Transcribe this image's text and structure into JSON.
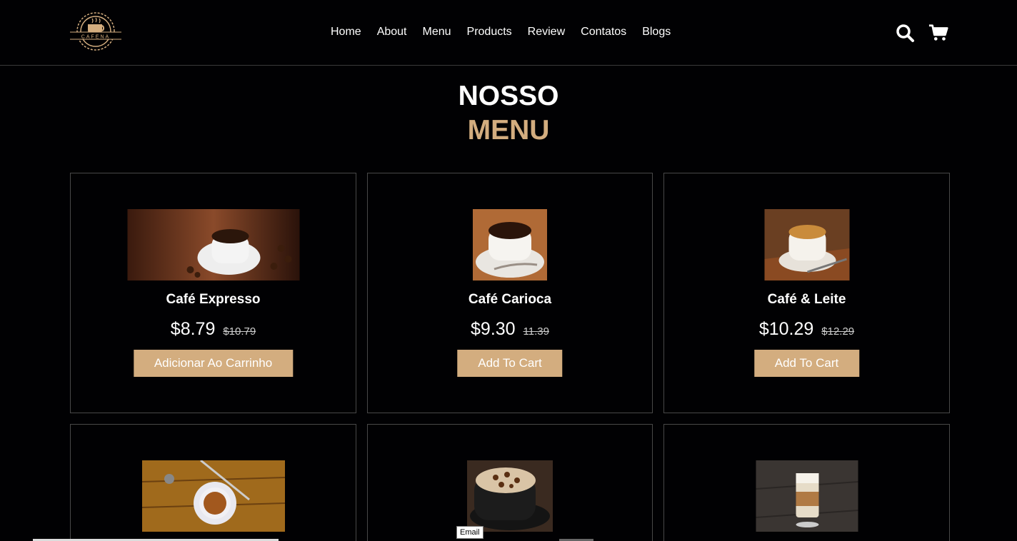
{
  "brand": {
    "logo_text": "CAFENA"
  },
  "nav": [
    "Home",
    "About",
    "Menu",
    "Products",
    "Review",
    "Contatos",
    "Blogs"
  ],
  "header_icons": {
    "search": "search-icon",
    "cart": "cart-icon"
  },
  "section": {
    "title_line1": "NOSSO",
    "title_line2": "MENU",
    "accent_color": "#d3ad7f"
  },
  "products": [
    {
      "name": "Café Expresso",
      "price": "$8.79",
      "old_price": "$10.79",
      "button": "Adicionar Ao Carrinho"
    },
    {
      "name": "Café Carioca",
      "price": "$9.30",
      "old_price": "11.39",
      "button": "Add To Cart"
    },
    {
      "name": "Café & Leite",
      "price": "$10.29",
      "old_price": "$12.29",
      "button": "Add To Cart"
    }
  ],
  "tooltip": "Email"
}
